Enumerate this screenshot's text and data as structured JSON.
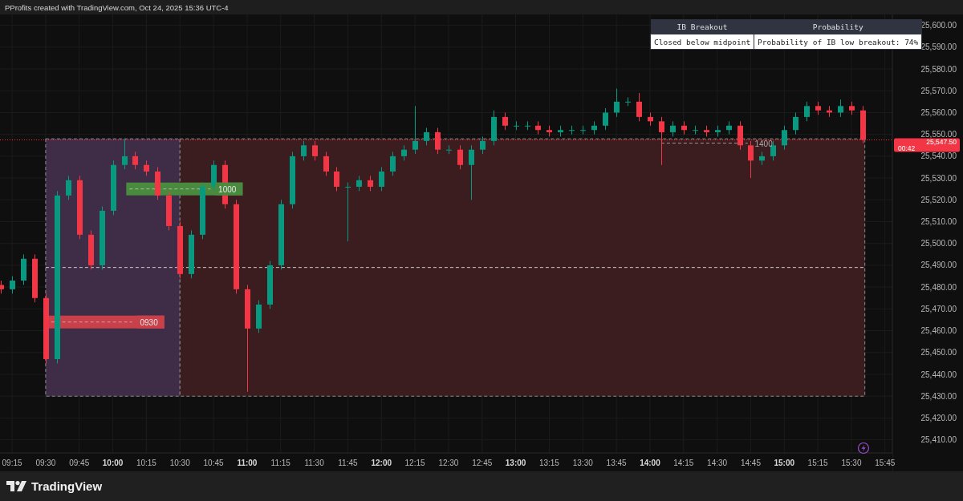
{
  "header": {
    "text": "PProfits created with TradingView.com, Oct 24, 2025 15:36 UTC-4"
  },
  "table": {
    "columns": [
      "IB Breakout",
      "Probability"
    ],
    "rows": [
      [
        "Closed below midpoint",
        "Probability of IB low breakout: 74%"
      ]
    ]
  },
  "chart": {
    "chart_data": {
      "type": "candlestick",
      "grid": true,
      "xlim": [
        549.6,
        948.3
      ],
      "ylim": [
        25404,
        25605
      ],
      "xticks": [
        {
          "value": 555,
          "label": "09:15"
        },
        {
          "value": 570,
          "label": "09:30"
        },
        {
          "value": 585,
          "label": "09:45"
        },
        {
          "value": 600,
          "label": "10:00"
        },
        {
          "value": 615,
          "label": "10:15"
        },
        {
          "value": 630,
          "label": "10:30"
        },
        {
          "value": 645,
          "label": "10:45"
        },
        {
          "value": 660,
          "label": "11:00"
        },
        {
          "value": 675,
          "label": "11:15"
        },
        {
          "value": 690,
          "label": "11:30"
        },
        {
          "value": 705,
          "label": "11:45"
        },
        {
          "value": 720,
          "label": "12:00"
        },
        {
          "value": 735,
          "label": "12:15"
        },
        {
          "value": 750,
          "label": "12:30"
        },
        {
          "value": 765,
          "label": "12:45"
        },
        {
          "value": 780,
          "label": "13:00"
        },
        {
          "value": 795,
          "label": "13:15"
        },
        {
          "value": 810,
          "label": "13:30"
        },
        {
          "value": 825,
          "label": "13:45"
        },
        {
          "value": 840,
          "label": "14:00"
        },
        {
          "value": 855,
          "label": "14:15"
        },
        {
          "value": 870,
          "label": "14:30"
        },
        {
          "value": 885,
          "label": "14:45"
        },
        {
          "value": 900,
          "label": "15:00"
        },
        {
          "value": 915,
          "label": "15:15"
        },
        {
          "value": 930,
          "label": "15:30"
        },
        {
          "value": 945,
          "label": "15:45"
        }
      ],
      "yticks": [
        {
          "value": 25410,
          "label": "25,410.00"
        },
        {
          "value": 25420,
          "label": "25,420.00"
        },
        {
          "value": 25430,
          "label": "25,430.00"
        },
        {
          "value": 25440,
          "label": "25,440.00"
        },
        {
          "value": 25450,
          "label": "25,450.00"
        },
        {
          "value": 25460,
          "label": "25,460.00"
        },
        {
          "value": 25470,
          "label": "25,470.00"
        },
        {
          "value": 25480,
          "label": "25,480.00"
        },
        {
          "value": 25490,
          "label": "25,490.00"
        },
        {
          "value": 25500,
          "label": "25,500.00"
        },
        {
          "value": 25510,
          "label": "25,510.00"
        },
        {
          "value": 25520,
          "label": "25,520.00"
        },
        {
          "value": 25530,
          "label": "25,530.00"
        },
        {
          "value": 25540,
          "label": "25,540.00"
        },
        {
          "value": 25550,
          "label": "25,550.00"
        },
        {
          "value": 25560,
          "label": "25,560.00"
        },
        {
          "value": 25570,
          "label": "25,570.00"
        },
        {
          "value": 25580,
          "label": "25,580.00"
        },
        {
          "value": 25590,
          "label": "25,590.00"
        },
        {
          "value": 25600,
          "label": "25,600.00"
        }
      ],
      "x": [
        550,
        555,
        560,
        565,
        570,
        575,
        580,
        585,
        590,
        595,
        600,
        605,
        610,
        615,
        620,
        625,
        630,
        635,
        640,
        645,
        650,
        655,
        660,
        665,
        670,
        675,
        680,
        685,
        690,
        695,
        700,
        705,
        710,
        715,
        720,
        725,
        730,
        735,
        740,
        745,
        750,
        755,
        760,
        765,
        770,
        775,
        780,
        785,
        790,
        795,
        800,
        805,
        810,
        815,
        820,
        825,
        830,
        835,
        840,
        845,
        850,
        855,
        860,
        865,
        870,
        875,
        880,
        885,
        890,
        895,
        900,
        905,
        910,
        915,
        920,
        925,
        930,
        935
      ],
      "ohlc": [
        [
          25481,
          25483,
          25477,
          25479
        ],
        [
          25479,
          25485,
          25477,
          25483
        ],
        [
          25483,
          25495,
          25481,
          25493
        ],
        [
          25493,
          25495,
          25473,
          25475
        ],
        [
          25475,
          25477,
          25445,
          25447
        ],
        [
          25447,
          25524,
          25445,
          25522
        ],
        [
          25522,
          25531,
          25520,
          25529
        ],
        [
          25529,
          25531,
          25502,
          25504
        ],
        [
          25504,
          25506,
          25488,
          25490
        ],
        [
          25490,
          25517,
          25488,
          25515
        ],
        [
          25515,
          25538,
          25513,
          25536
        ],
        [
          25536,
          25548,
          25534,
          25540
        ],
        [
          25540,
          25542,
          25534,
          25536
        ],
        [
          25536,
          25538,
          25531,
          25533
        ],
        [
          25533,
          25535,
          25520,
          25522
        ],
        [
          25522,
          25524,
          25506,
          25508
        ],
        [
          25508,
          25510,
          25484,
          25486
        ],
        [
          25486,
          25506,
          25484,
          25504
        ],
        [
          25504,
          25528,
          25502,
          25526
        ],
        [
          25526,
          25538,
          25524,
          25536
        ],
        [
          25536,
          25538,
          25516,
          25518
        ],
        [
          25518,
          25520,
          25477,
          25479
        ],
        [
          25479,
          25481,
          25432,
          25461
        ],
        [
          25461,
          25474,
          25459,
          25472
        ],
        [
          25472,
          25492,
          25470,
          25490
        ],
        [
          25490,
          25520,
          25488,
          25518
        ],
        [
          25518,
          25542,
          25516,
          25540
        ],
        [
          25540,
          25547,
          25538,
          25545
        ],
        [
          25545,
          25547,
          25538,
          25540
        ],
        [
          25540,
          25542,
          25531,
          25533
        ],
        [
          25533,
          25535,
          25524,
          25526
        ],
        [
          25526,
          25528,
          25501,
          25526
        ],
        [
          25526,
          25531,
          25524,
          25529
        ],
        [
          25529,
          25531,
          25524,
          25526
        ],
        [
          25526,
          25535,
          25524,
          25533
        ],
        [
          25533,
          25542,
          25531,
          25540
        ],
        [
          25540,
          25545,
          25538,
          25543
        ],
        [
          25543,
          25563,
          25541,
          25547
        ],
        [
          25547,
          25553,
          25545,
          25551
        ],
        [
          25551,
          25553,
          25541,
          25543
        ],
        [
          25543,
          25545,
          25541,
          25543
        ],
        [
          25543,
          25545,
          25534,
          25536
        ],
        [
          25536,
          25545,
          25520,
          25543
        ],
        [
          25543,
          25549,
          25541,
          25547
        ],
        [
          25547,
          25561,
          25545,
          25558
        ],
        [
          25558,
          25560,
          25552,
          25554
        ],
        [
          25554,
          25556,
          25552,
          25554
        ],
        [
          25554,
          25556,
          25552,
          25554
        ],
        [
          25554,
          25556,
          25550,
          25552
        ],
        [
          25552,
          25554,
          25549,
          25551
        ],
        [
          25551,
          25554,
          25549,
          25552
        ],
        [
          25552,
          25554,
          25550,
          25552
        ],
        [
          25552,
          25554,
          25550,
          25552
        ],
        [
          25552,
          25556,
          25550,
          25554
        ],
        [
          25554,
          25562,
          25552,
          25560
        ],
        [
          25560,
          25571,
          25558,
          25565
        ],
        [
          25565,
          25567,
          25563,
          25565
        ],
        [
          25565,
          25569,
          25556,
          25558
        ],
        [
          25558,
          25560,
          25554,
          25556
        ],
        [
          25556,
          25558,
          25536,
          25551
        ],
        [
          25551,
          25556,
          25549,
          25554
        ],
        [
          25554,
          25556,
          25550,
          25552
        ],
        [
          25552,
          25554,
          25550,
          25552
        ],
        [
          25552,
          25554,
          25549,
          25551
        ],
        [
          25551,
          25554,
          25549,
          25552
        ],
        [
          25552,
          25556,
          25550,
          25554
        ],
        [
          25554,
          25556,
          25543,
          25545
        ],
        [
          25545,
          25547,
          25530,
          25538
        ],
        [
          25538,
          25542,
          25536,
          25540
        ],
        [
          25540,
          25547,
          25538,
          25545
        ],
        [
          25545,
          25554,
          25543,
          25552
        ],
        [
          25552,
          25560,
          25550,
          25558
        ],
        [
          25558,
          25565,
          25556,
          25563
        ],
        [
          25563,
          25565,
          25559,
          25561
        ],
        [
          25561,
          25563,
          25558,
          25560
        ],
        [
          25560,
          25566,
          25558,
          25563
        ],
        [
          25563,
          25565,
          25559,
          25561
        ],
        [
          25561,
          25563,
          25546,
          25547.5
        ]
      ],
      "ref_lines": [
        {
          "axis": "y",
          "value": 25489
        },
        {
          "axis": "y",
          "value": 25547.5,
          "color": "#f23645"
        }
      ]
    },
    "drawings": [
      {
        "kind": "box",
        "color": "#3f2c47"
      },
      {
        "kind": "box",
        "color": "#3b1d1f"
      },
      {
        "kind": "level",
        "label": "1000",
        "color": "#4a8a3e"
      },
      {
        "kind": "level",
        "label": "0930",
        "color": "#c8404a"
      },
      {
        "kind": "marker",
        "label": "1400"
      }
    ],
    "last_price": {
      "value": "25,547.50",
      "countdown": "00:42"
    }
  },
  "footer": {
    "logo": "TradingView"
  }
}
